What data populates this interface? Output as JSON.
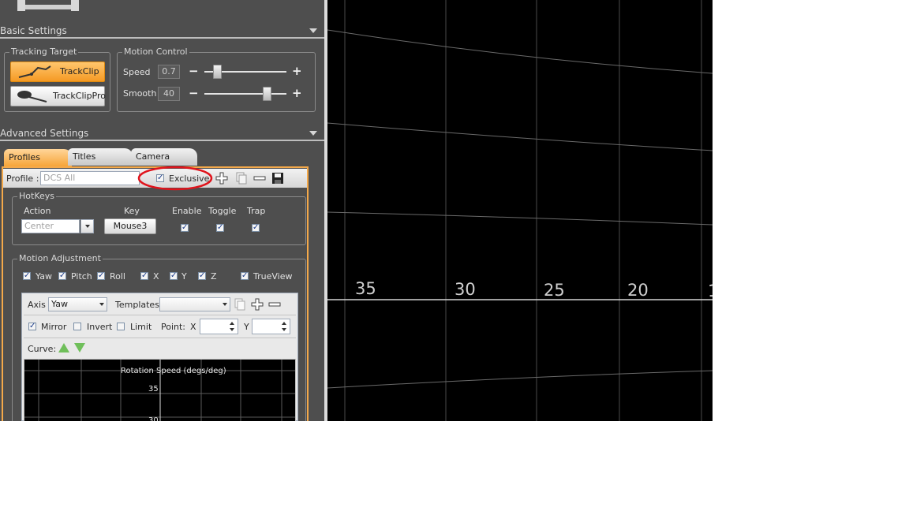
{
  "basic_settings": {
    "title": "Basic Settings"
  },
  "tracking_target": {
    "title": "Tracking Target",
    "buttons": [
      {
        "label": "TrackClip"
      },
      {
        "label": "TrackClipPro"
      }
    ]
  },
  "motion_control": {
    "title": "Motion Control",
    "speed": {
      "label": "Speed",
      "value": "0.7",
      "level": 0.12
    },
    "smooth": {
      "label": "Smooth",
      "value": "40",
      "level": 0.78
    },
    "minus": "−",
    "plus": "+"
  },
  "advanced_settings": {
    "title": "Advanced Settings"
  },
  "tabs": [
    {
      "label": "Profiles"
    },
    {
      "label": "Titles"
    },
    {
      "label": "Camera"
    }
  ],
  "profile_bar": {
    "label": "Profile :",
    "value": "DCS All",
    "exclusive_label": "Exclusive"
  },
  "hotkeys": {
    "title": "HotKeys",
    "columns": {
      "action": "Action",
      "key": "Key",
      "enable": "Enable",
      "toggle": "Toggle",
      "trap": "Trap"
    },
    "action_placeholder": "Center",
    "key_value": "Mouse3"
  },
  "motion_adjustment": {
    "title": "Motion Adjustment",
    "axes": [
      "Yaw",
      "Pitch",
      "Roll",
      "X",
      "Y",
      "Z",
      "TrueView"
    ],
    "axis_label": "Axis",
    "axis_value": "Yaw",
    "templates_label": "Templates",
    "mirror_label": "Mirror",
    "invert_label": "Invert",
    "limit_label": "Limit",
    "point_label": "Point:",
    "x_label": "X",
    "y_label": "Y",
    "curve_label": "Curve:"
  },
  "mini_chart": {
    "title": "Rotation Speed (degs/deg)",
    "tick_35": "35",
    "tick_30": "30"
  },
  "right_view": {
    "ticks": [
      "35",
      "30",
      "25",
      "20",
      "1"
    ]
  },
  "colors": {
    "accent": "#f59a24",
    "annotation": "#e0141c",
    "panel": "#4e4e4e"
  },
  "check_mark": "✓"
}
